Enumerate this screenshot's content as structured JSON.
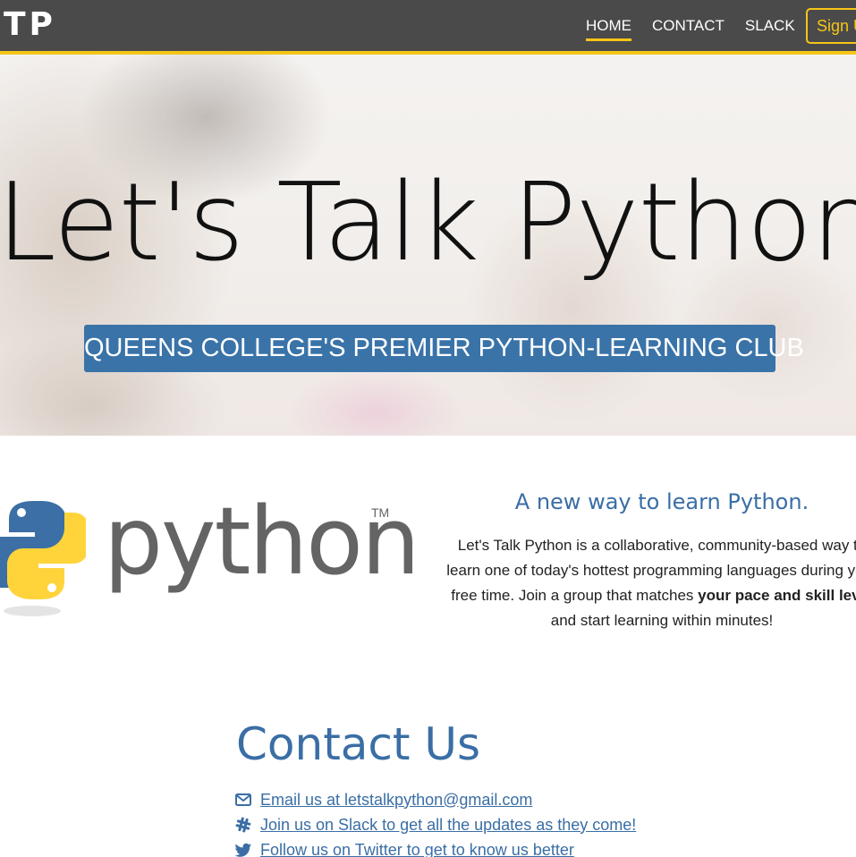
{
  "nav": {
    "brand": "TP",
    "links": [
      {
        "label": "HOME",
        "active": true
      },
      {
        "label": "CONTACT",
        "active": false
      },
      {
        "label": "SLACK",
        "active": false
      }
    ],
    "signup_label": "Sign Up"
  },
  "hero": {
    "title": "Let's Talk Python",
    "tagline": "QUEENS COLLEGE'S PREMIER PYTHON-LEARNING CLUB"
  },
  "logo": {
    "word": "python",
    "tm": "TM"
  },
  "about": {
    "heading": "A new way to learn Python.",
    "text_pre": "Let's Talk Python is a collaborative, community-based way to learn one of today's hottest programming languages during your free time. Join a group that matches ",
    "text_bold": "your pace and skill level",
    "text_post": " and start learning within minutes!"
  },
  "contact": {
    "heading": "Contact Us",
    "items": [
      {
        "icon": "envelope-icon",
        "label": "Email us at letstalkpython@gmail.com"
      },
      {
        "icon": "slack-icon",
        "label": "Join us on Slack to get all the updates as they come!"
      },
      {
        "icon": "twitter-icon",
        "label": "Follow us on Twitter to get to know us better"
      }
    ]
  },
  "colors": {
    "navbar": "#4a4a4a",
    "accent": "#f5c518",
    "brand_blue": "#3a73a8"
  }
}
